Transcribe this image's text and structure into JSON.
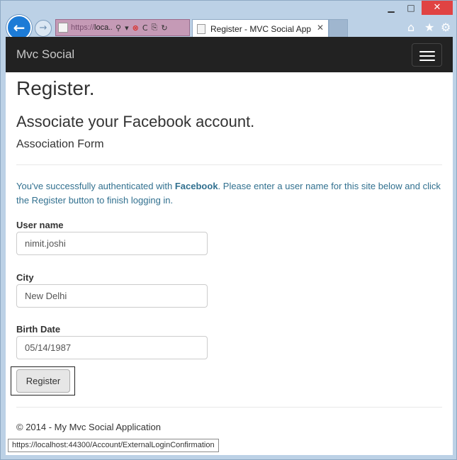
{
  "window": {
    "minimize_glyph": "▁",
    "maximize_glyph": "□",
    "close_glyph": "✕"
  },
  "browser": {
    "back_glyph": "←",
    "forward_glyph": "→",
    "address_url_prefix": "https://",
    "address_url_host": "loca...",
    "tab_title": "Register - MVC Social App",
    "tab_close_glyph": "✕",
    "icons": {
      "search": "⚲",
      "dropdown": "▾",
      "error": "⊗",
      "certificate": "C",
      "compat": "⎘",
      "refresh": "↻",
      "home": "⌂",
      "favorites": "★",
      "tools": "⚙"
    }
  },
  "navbar": {
    "brand": "Mvc Social"
  },
  "page": {
    "title": "Register.",
    "subtitle": "Associate your Facebook account.",
    "section": "Association Form",
    "info_before": "You've successfully authenticated with ",
    "info_provider": "Facebook",
    "info_after": ". Please enter a user name for this site below and click the Register button to finish logging in."
  },
  "form": {
    "username_label": "User name",
    "username_value": "nimit.joshi",
    "city_label": "City",
    "city_value": "New Delhi",
    "birthdate_label": "Birth Date",
    "birthdate_value": "05/14/1987",
    "register_label": "Register"
  },
  "footer": {
    "text": "© 2014 - My Mvc Social Application"
  },
  "status_bar": {
    "url": "https://localhost:44300/Account/ExternalLoginConfirmation"
  },
  "colors": {
    "navbar": "#222222",
    "info_text": "#31708f",
    "back_button": "#1d7bd6",
    "close_button": "#e04343",
    "address_bar": "#c59ab6"
  }
}
